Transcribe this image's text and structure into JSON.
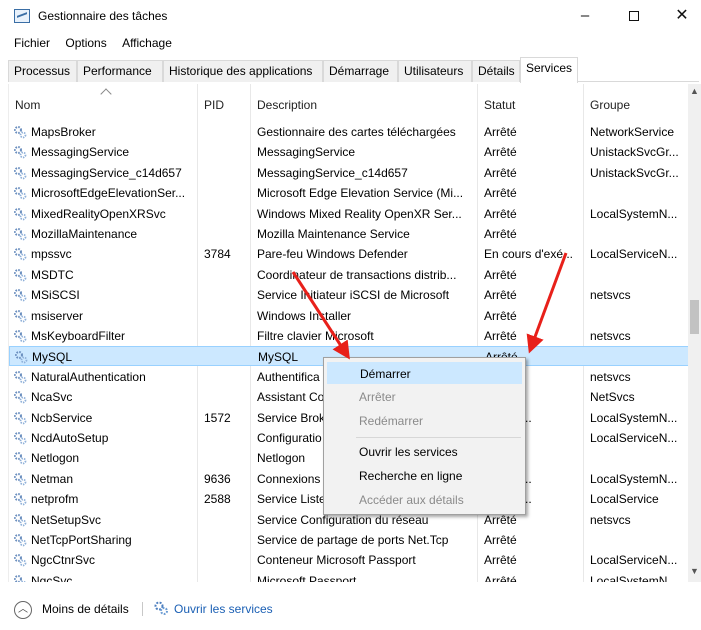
{
  "window": {
    "title": "Gestionnaire des tâches",
    "minimize": "–",
    "close": "✕"
  },
  "menu": [
    "Fichier",
    "Options",
    "Affichage"
  ],
  "tabs": [
    "Processus",
    "Performance",
    "Historique des applications",
    "Démarrage",
    "Utilisateurs",
    "Détails",
    "Services"
  ],
  "active_tab": "Services",
  "columns": {
    "name": "Nom",
    "pid": "PID",
    "description": "Description",
    "status": "Statut",
    "group": "Groupe"
  },
  "rows": [
    {
      "name": "MapsBroker",
      "pid": "",
      "description": "Gestionnaire des cartes téléchargées",
      "status": "Arrêté",
      "group": "NetworkService"
    },
    {
      "name": "MessagingService",
      "pid": "",
      "description": "MessagingService",
      "status": "Arrêté",
      "group": "UnistackSvcGr..."
    },
    {
      "name": "MessagingService_c14d657",
      "pid": "",
      "description": "MessagingService_c14d657",
      "status": "Arrêté",
      "group": "UnistackSvcGr..."
    },
    {
      "name": "MicrosoftEdgeElevationSer...",
      "pid": "",
      "description": "Microsoft Edge Elevation Service (Mi...",
      "status": "Arrêté",
      "group": ""
    },
    {
      "name": "MixedRealityOpenXRSvc",
      "pid": "",
      "description": "Windows Mixed Reality OpenXR Ser...",
      "status": "Arrêté",
      "group": "LocalSystemN..."
    },
    {
      "name": "MozillaMaintenance",
      "pid": "",
      "description": "Mozilla Maintenance Service",
      "status": "Arrêté",
      "group": ""
    },
    {
      "name": "mpssvc",
      "pid": "3784",
      "description": "Pare-feu Windows Defender",
      "status": "En cours d'exé...",
      "group": "LocalServiceN..."
    },
    {
      "name": "MSDTC",
      "pid": "",
      "description": "Coordinateur de transactions distrib...",
      "status": "Arrêté",
      "group": ""
    },
    {
      "name": "MSiSCSI",
      "pid": "",
      "description": "Service Initiateur iSCSI de Microsoft",
      "status": "Arrêté",
      "group": "netsvcs"
    },
    {
      "name": "msiserver",
      "pid": "",
      "description": "Windows Installer",
      "status": "Arrêté",
      "group": ""
    },
    {
      "name": "MsKeyboardFilter",
      "pid": "",
      "description": "Filtre clavier Microsoft",
      "status": "Arrêté",
      "group": "netsvcs"
    },
    {
      "name": "MySQL",
      "pid": "",
      "description": "MySQL",
      "status": "Arrêté",
      "group": ""
    },
    {
      "name": "NaturalAuthentication",
      "pid": "",
      "description": "Authentifica",
      "status": "",
      "group": "netsvcs"
    },
    {
      "name": "NcaSvc",
      "pid": "",
      "description": "Assistant Co",
      "status": "",
      "group": "NetSvcs"
    },
    {
      "name": "NcbService",
      "pid": "1572",
      "description": "Service Brok",
      "status": "s d'exé...",
      "group": "LocalSystemN..."
    },
    {
      "name": "NcdAutoSetup",
      "pid": "",
      "description": "Configuratio",
      "status": "",
      "group": "LocalServiceN..."
    },
    {
      "name": "Netlogon",
      "pid": "",
      "description": "Netlogon",
      "status": "",
      "group": ""
    },
    {
      "name": "Netman",
      "pid": "9636",
      "description": "Connexions",
      "status": "s d'exé...",
      "group": "LocalSystemN..."
    },
    {
      "name": "netprofm",
      "pid": "2588",
      "description": "Service Liste",
      "status": "s d'exé...",
      "group": "LocalService"
    },
    {
      "name": "NetSetupSvc",
      "pid": "",
      "description": "Service Configuration du réseau",
      "status": "Arrêté",
      "group": "netsvcs"
    },
    {
      "name": "NetTcpPortSharing",
      "pid": "",
      "description": "Service de partage de ports Net.Tcp",
      "status": "Arrêté",
      "group": ""
    },
    {
      "name": "NgcCtnrSvc",
      "pid": "",
      "description": "Conteneur Microsoft Passport",
      "status": "Arrêté",
      "group": "LocalServiceN..."
    },
    {
      "name": "NgcSvc",
      "pid": "",
      "description": "Microsoft Passport",
      "status": "Arrêté",
      "group": "LocalSystemN..."
    }
  ],
  "selected_row": "MySQL",
  "context_menu": {
    "start": "Démarrer",
    "stop": "Arrêter",
    "restart": "Redémarrer",
    "open_services": "Ouvrir les services",
    "search_online": "Recherche en ligne",
    "details": "Accéder aux détails"
  },
  "footer": {
    "fewer_details": "Moins de détails",
    "open_services": "Ouvrir les services"
  },
  "colors": {
    "selection": "#cce8ff",
    "link": "#1a5fb4",
    "annotation_arrow": "#e8201a"
  }
}
